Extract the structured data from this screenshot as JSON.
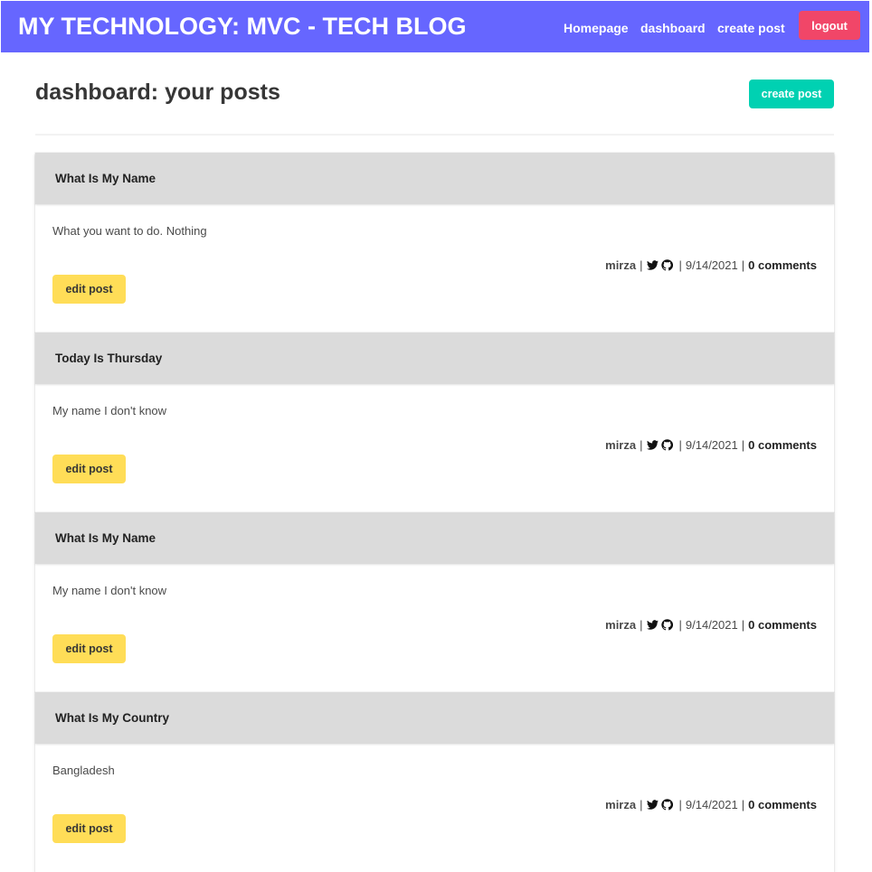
{
  "navbar": {
    "brand": "MY TECHNOLOGY: MVC - TECH BLOG",
    "links": [
      "Homepage",
      "dashboard",
      "create post"
    ],
    "logout_label": "logout",
    "color": "#6666ff"
  },
  "page": {
    "title": "dashboard: your posts",
    "create_button_label": "create post"
  },
  "posts": [
    {
      "title": "What Is My Name",
      "body": "What you want to do. Nothing",
      "author": "mirza",
      "date": "9/14/2021",
      "comments": "0 comments",
      "edit_label": "edit post"
    },
    {
      "title": "Today Is Thursday",
      "body": "My name I don't know",
      "author": "mirza",
      "date": "9/14/2021",
      "comments": "0 comments",
      "edit_label": "edit post"
    },
    {
      "title": "What Is My Name",
      "body": "My name I don't know",
      "author": "mirza",
      "date": "9/14/2021",
      "comments": "0 comments",
      "edit_label": "edit post"
    },
    {
      "title": "What Is My Country",
      "body": "Bangladesh",
      "author": "mirza",
      "date": "9/14/2021",
      "comments": "0 comments",
      "edit_label": "edit post"
    }
  ],
  "icons": [
    "twitter-icon",
    "github-icon"
  ],
  "colors": {
    "primary": "#00d1b2",
    "danger": "#f14668",
    "warning": "#ffdd57",
    "card_header": "#dbdbdb"
  }
}
